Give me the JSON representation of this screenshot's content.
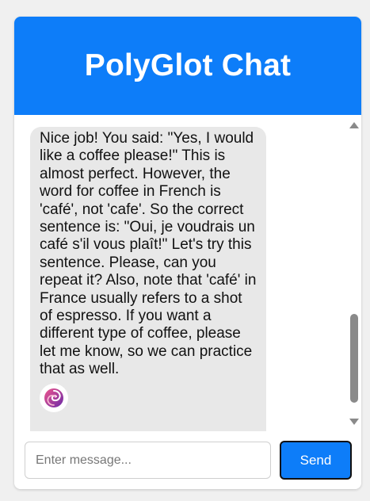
{
  "header": {
    "title": "PolyGlot Chat"
  },
  "messages": [
    {
      "sender": "bot",
      "text": "Nice job! You said: \"Yes, I would like a coffee please!\" This is almost perfect. However, the word for coffee in French is 'café', not 'cafe'. So the correct sentence is: \"Oui, je voudrais un café s'il vous plaît!\" Let's try this sentence. Please, can you repeat it? Also, note that 'café' in France usually refers to a shot of espresso. If you want a different type of coffee, please let me know, so we can practice that as well.",
      "avatar_icon": "swirl-logo-icon"
    }
  ],
  "composer": {
    "placeholder": "Enter message...",
    "value": "",
    "send_label": "Send"
  },
  "colors": {
    "accent": "#0d7df9",
    "bubble": "#e8e8e8",
    "avatar_gradient": [
      "#e0407a",
      "#7a2fb0"
    ]
  }
}
